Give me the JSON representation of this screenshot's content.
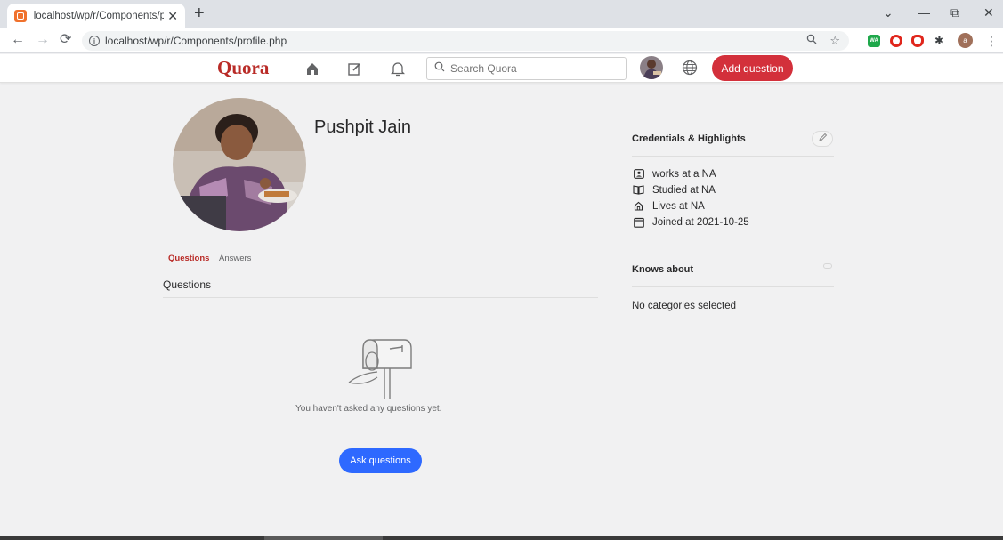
{
  "browser": {
    "tab_title": "localhost/wp/r/Components/pro",
    "tab_close": "✕",
    "new_tab": "+",
    "url": "localhost/wp/r/Components/profile.php",
    "window_controls": {
      "chevron": "⌄",
      "minimize": "—",
      "restore": "⧉",
      "close": "✕"
    },
    "ext_wa_label": "WA",
    "profile_initial": "a"
  },
  "quora_header": {
    "logo": "Quora",
    "search_placeholder": "Search Quora",
    "add_question_label": "Add question",
    "icons": [
      "home-icon",
      "edit-icon",
      "bell-icon",
      "search-icon",
      "globe-icon"
    ]
  },
  "profile": {
    "name": "Pushpit Jain",
    "tabs": [
      {
        "label": "Questions",
        "active": true
      },
      {
        "label": "Answers",
        "active": false
      }
    ],
    "section_label": "Questions",
    "empty_message": "You haven't asked any questions yet.",
    "ask_button_label": "Ask questions"
  },
  "sidebar": {
    "credentials_title": "Credentials & Highlights",
    "credentials": [
      {
        "icon": "briefcase-icon",
        "text": "works at a NA"
      },
      {
        "icon": "book-icon",
        "text": "Studied at NA"
      },
      {
        "icon": "house-icon",
        "text": "Lives at NA"
      },
      {
        "icon": "calendar-icon",
        "text": "Joined at 2021-10-25"
      }
    ],
    "knows_about_title": "Knows about",
    "knows_about_empty": "No categories selected"
  },
  "colors": {
    "brand_red": "#b92b27",
    "add_question_bg": "#d3303b",
    "ask_button_bg": "#2e69ff",
    "page_bg": "#f1f1f2"
  }
}
